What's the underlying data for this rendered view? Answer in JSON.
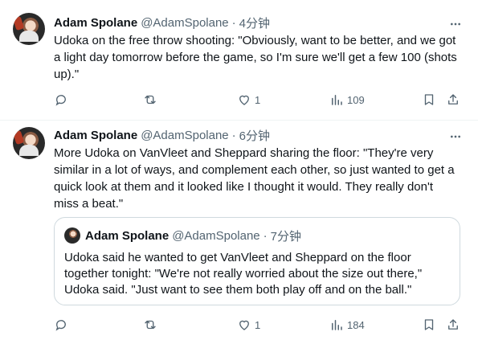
{
  "tweets": [
    {
      "author_name": "Adam Spolane",
      "handle": "@AdamSpolane",
      "separator": "·",
      "time": "4分钟",
      "text": "Udoka on the free throw shooting: \"Obviously, want to be better, and we got\na light day tomorrow before the game, so I'm sure we'll get a few 100 (shots\nup).\"",
      "actions": {
        "reply_count": "",
        "retweet_count": "",
        "like_count": "1",
        "views_count": "109"
      }
    },
    {
      "author_name": "Adam Spolane",
      "handle": "@AdamSpolane",
      "separator": "·",
      "time": "6分钟",
      "text": "More Udoka on VanVleet and Sheppard sharing the floor: \"They're very\nsimilar in a lot of ways, and complement each other, so just wanted to get a\nquick look at them and it looked like I thought it would. They really don't\nmiss a beat.\"",
      "quote": {
        "author_name": "Adam Spolane",
        "handle": "@AdamSpolane",
        "separator": "·",
        "time": "7分钟",
        "text": "Udoka said he wanted to get VanVleet and Sheppard on the floor\ntogether tonight: \"We're not really worried about the size out there,\"\nUdoka said. \"Just want to see them both play off and on the ball.\""
      },
      "actions": {
        "reply_count": "",
        "retweet_count": "",
        "like_count": "1",
        "views_count": "184"
      }
    }
  ],
  "icons": {
    "more": "more-horizontal-icon",
    "reply": "reply-icon",
    "retweet": "retweet-icon",
    "like": "heart-icon",
    "views": "views-chart-icon",
    "bookmark": "bookmark-icon",
    "share": "share-icon"
  },
  "colors": {
    "text": "#0f1419",
    "secondary": "#536471",
    "border": "#cfd9de",
    "divider": "#eff3f4"
  }
}
